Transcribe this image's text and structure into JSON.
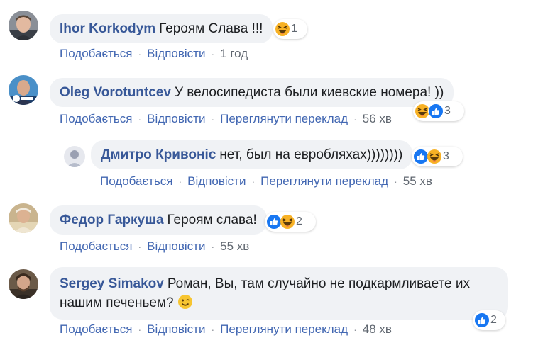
{
  "comments": [
    {
      "author": "Ihor Korkodym",
      "text": "Героям Слава !!!",
      "reactions": {
        "icons": [
          "haha-icon"
        ],
        "count": "1"
      },
      "actions": {
        "like": "Подобається",
        "reply": "Відповісти",
        "time": "1 год"
      }
    },
    {
      "author": "Oleg Vorotuntcev",
      "text": "У велосипедиста были киевские номера! ))",
      "reactions": {
        "icons": [
          "haha-icon",
          "like-icon"
        ],
        "count": "3"
      },
      "actions": {
        "like": "Подобається",
        "reply": "Відповісти",
        "translate": "Переглянути переклад",
        "time": "56 хв"
      }
    },
    {
      "author": "Дмитро Кривоніс",
      "text": "нет, был на евробляхах))))))))",
      "reactions": {
        "icons": [
          "like-icon",
          "haha-icon"
        ],
        "count": "3"
      },
      "actions": {
        "like": "Подобається",
        "reply": "Відповісти",
        "translate": "Переглянути переклад",
        "time": "55 хв"
      }
    },
    {
      "author": "Федор Гаркуша",
      "text": "Героям слава!",
      "reactions": {
        "icons": [
          "like-icon",
          "haha-icon"
        ],
        "count": "2"
      },
      "actions": {
        "like": "Подобається",
        "reply": "Відповісти",
        "time": "55 хв"
      }
    },
    {
      "author": "Sergey Simakov",
      "text_line1": "Роман, Вы, там случайно не подкармливаете их",
      "text_line2": "нашим печеньем?",
      "inline_emoji": "wink-emoji-icon",
      "reactions": {
        "icons": [
          "like-icon"
        ],
        "count": "2"
      },
      "actions": {
        "like": "Подобається",
        "reply": "Відповісти",
        "translate": "Переглянути переклад",
        "time": "48 хв"
      }
    }
  ],
  "colors": {
    "bubble": "#f0f2f5",
    "author": "#385898",
    "link": "#4267b2",
    "meta": "#606770",
    "like": "#1877f2",
    "haha": "#f7b125"
  }
}
